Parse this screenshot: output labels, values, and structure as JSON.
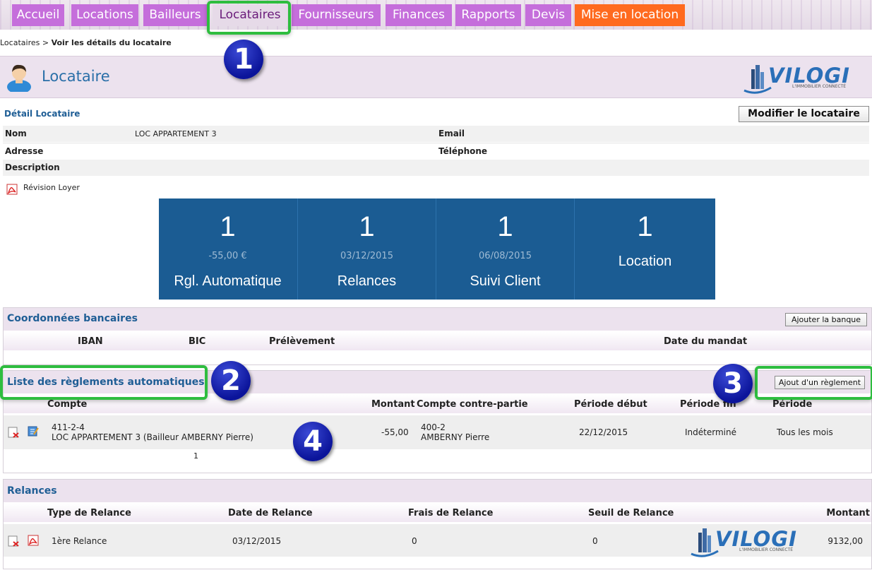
{
  "nav": {
    "tabs": [
      "Accueil",
      "Locations",
      "Bailleurs",
      "Locataires",
      "Fournisseurs",
      "Finances",
      "Rapports",
      "Devis",
      "Mise en location"
    ]
  },
  "breadcrumb": {
    "parent": "Locataires",
    "separator": " > ",
    "current": "Voir les détails du locataire"
  },
  "header": {
    "title": "Locataire",
    "logo_text": "VILOGI",
    "logo_tagline": "L'IMMOBILIER CONNECTÉ"
  },
  "badges": [
    "1",
    "2",
    "3",
    "4"
  ],
  "detail": {
    "section_title": "Détail Locataire",
    "edit_button": "Modifier le locataire",
    "fields": {
      "nom_label": "Nom",
      "nom_value": "LOC APPARTEMENT 3",
      "email_label": "Email",
      "adresse_label": "Adresse",
      "telephone_label": "Téléphone",
      "description_label": "Description"
    },
    "revision_link": "Révision Loyer"
  },
  "tiles": [
    {
      "count": "1",
      "sub": "-55,00 €",
      "caption": "Rgl. Automatique"
    },
    {
      "count": "1",
      "sub": "03/12/2015",
      "caption": "Relances"
    },
    {
      "count": "1",
      "sub": "06/08/2015",
      "caption": "Suivi Client"
    },
    {
      "count": "1",
      "sub": "",
      "caption": "Location"
    }
  ],
  "bank": {
    "title": "Coordonnées bancaires",
    "add_button": "Ajouter la banque",
    "columns": [
      "IBAN",
      "BIC",
      "Prélèvement",
      "Date du mandat"
    ]
  },
  "reglements": {
    "title": "Liste des règlements automatiques",
    "add_button": "Ajout d'un règlement",
    "columns": [
      "Compte",
      "Montant",
      "Compte contre-partie",
      "Période début",
      "Période fin",
      "Période"
    ],
    "rows": [
      {
        "compte_code": "411-2-4",
        "compte_name": "LOC APPARTEMENT 3 (Bailleur AMBERNY Pierre)",
        "montant": "-55,00",
        "contre_code": "400-2",
        "contre_name": "AMBERNY Pierre",
        "debut": "22/12/2015",
        "fin": "Indéterminé",
        "periode": "Tous les mois"
      }
    ],
    "pagination": "1"
  },
  "relances": {
    "title": "Relances",
    "columns": [
      "Type de Relance",
      "Date de Relance",
      "Frais de Relance",
      "Seuil de Relance",
      "Montant"
    ],
    "rows": [
      {
        "type": "1ère Relance",
        "date": "03/12/2015",
        "frais": "0",
        "seuil": "0",
        "montant": "9132,00"
      }
    ]
  },
  "colors": {
    "nav_purple": "#c56edb",
    "nav_orange": "#ff6a1f",
    "tile_blue": "#1b5c93",
    "highlight_green": "#2ebd3f",
    "badge_blue": "#0b149a"
  }
}
